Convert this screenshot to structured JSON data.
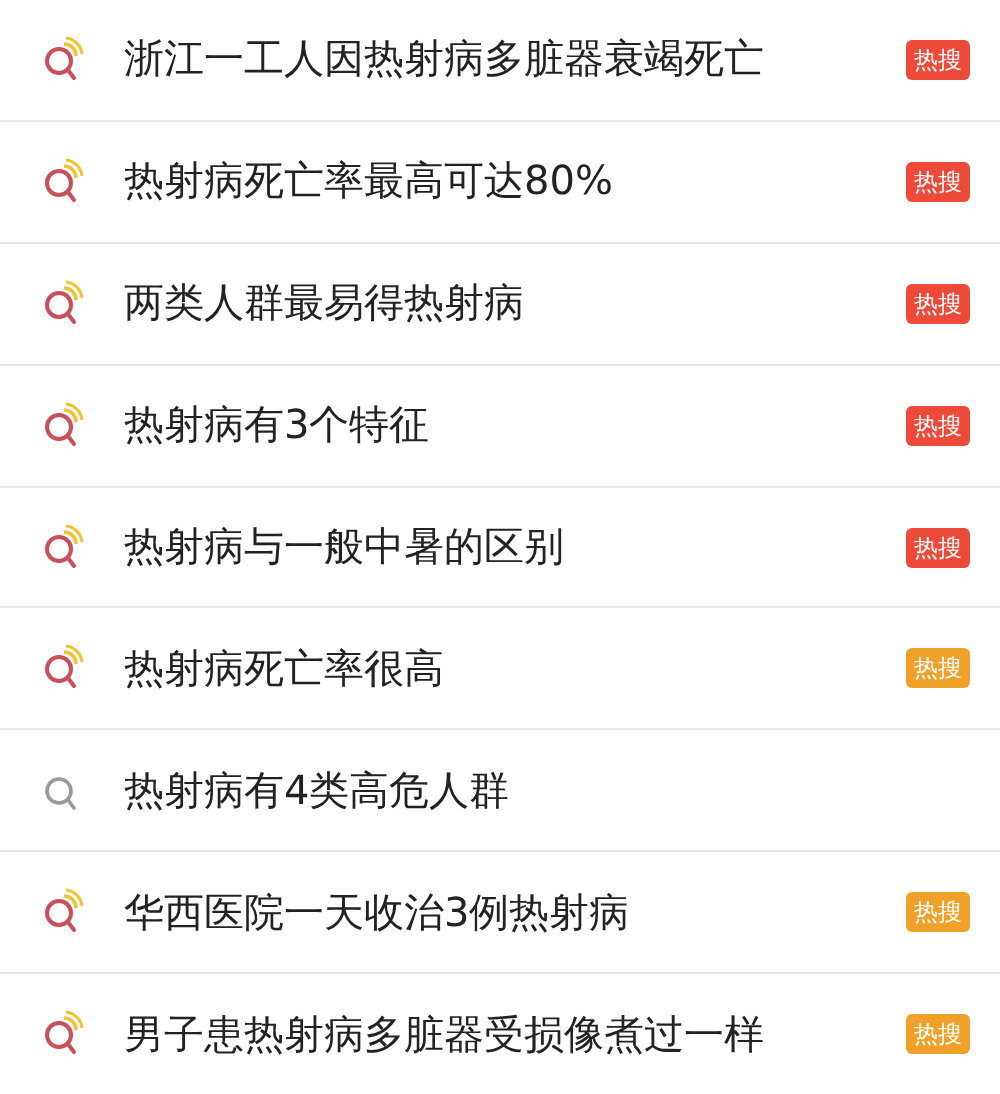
{
  "suggestions": [
    {
      "text": "浙江一工人因热射病多脏器衰竭死亡",
      "kind": "hot",
      "badge": {
        "text": "热搜",
        "color": "#ee4a3a"
      }
    },
    {
      "text": "热射病死亡率最高可达80%",
      "kind": "hot",
      "badge": {
        "text": "热搜",
        "color": "#ee4a3a"
      }
    },
    {
      "text": "两类人群最易得热射病",
      "kind": "hot",
      "badge": {
        "text": "热搜",
        "color": "#ee4a3a"
      }
    },
    {
      "text": "热射病有3个特征",
      "kind": "hot",
      "badge": {
        "text": "热搜",
        "color": "#ee4a3a"
      }
    },
    {
      "text": "热射病与一般中暑的区别",
      "kind": "hot",
      "badge": {
        "text": "热搜",
        "color": "#ee4a3a"
      }
    },
    {
      "text": "热射病死亡率很高",
      "kind": "hot",
      "badge": {
        "text": "热搜",
        "color": "#f0a12a"
      }
    },
    {
      "text": "热射病有4类高危人群",
      "kind": "plain"
    },
    {
      "text": "华西医院一天收治3例热射病",
      "kind": "hot",
      "badge": {
        "text": "热搜",
        "color": "#f0a12a"
      }
    },
    {
      "text": "男子患热射病多脏器受损像煮过一样",
      "kind": "hot",
      "badge": {
        "text": "热搜",
        "color": "#f0a12a"
      }
    }
  ]
}
